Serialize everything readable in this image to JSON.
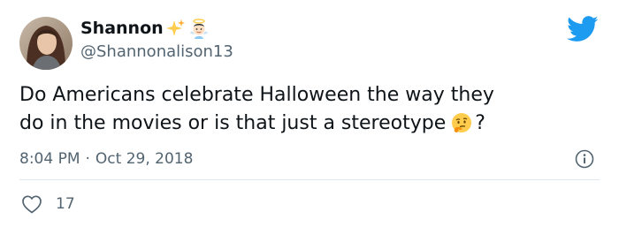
{
  "user": {
    "display_name": "Shannon",
    "handle": "@Shannonalison13",
    "name_emojis": [
      "sparkles-emoji",
      "angel-emoji"
    ]
  },
  "tweet": {
    "text_line1": "Do Americans celebrate Halloween the way they",
    "text_line2": "do in the movies or is that just a stereotype",
    "text_suffix": "?",
    "inline_emoji": "thinking-face-emoji",
    "time": "8:04 PM",
    "separator": "·",
    "date": "Oct 29, 2018"
  },
  "stats": {
    "likes": "17"
  },
  "colors": {
    "twitter_blue": "#1d9bf0",
    "text": "#0f1419",
    "secondary": "#536471",
    "divider": "#e1e8ed"
  }
}
